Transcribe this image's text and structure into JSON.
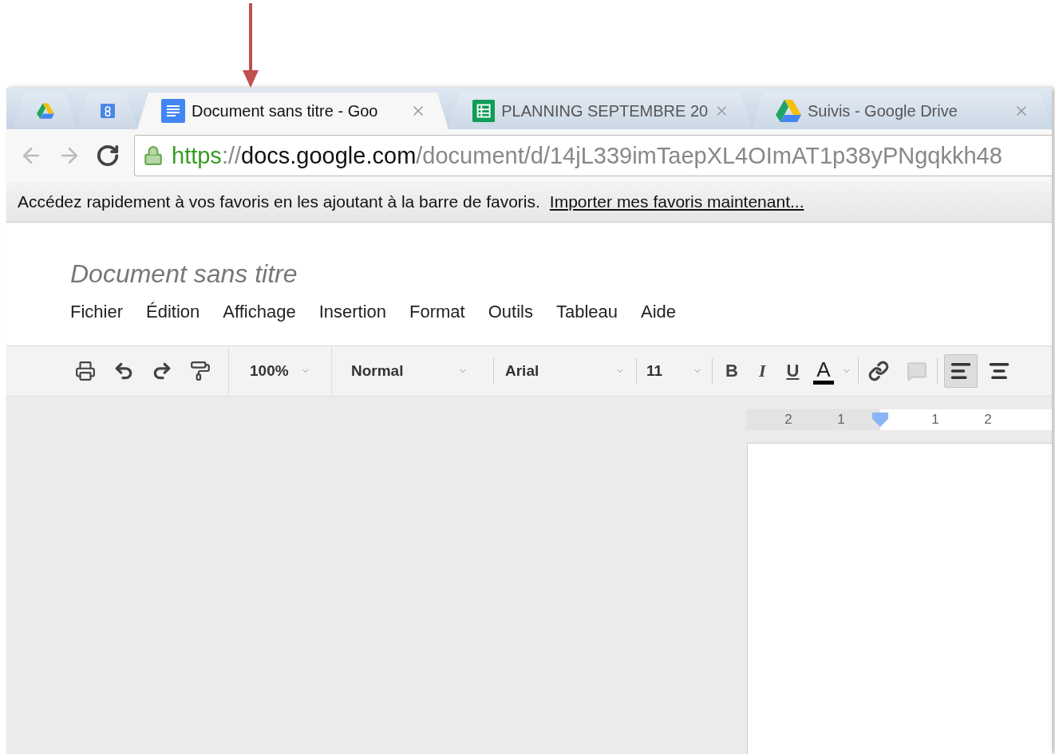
{
  "browser": {
    "tabs": [
      {
        "kind": "pinned",
        "selected": false
      },
      {
        "kind": "pinned",
        "selected": false
      },
      {
        "kind": "normal",
        "title": "Document sans titre - Goo",
        "selected": true
      },
      {
        "kind": "normal",
        "title": "PLANNING SEPTEMBRE 20",
        "selected": false
      },
      {
        "kind": "normal",
        "title": "Suivis - Google Drive",
        "selected": false
      }
    ],
    "address": {
      "secure": true,
      "scheme": "https",
      "separator": "://",
      "host": "docs.google.com",
      "path": "/document/d/14jL339imTaepXL4OImAT1p38yPNgqkkh48"
    },
    "bookmarks_bar": {
      "message": "Accédez rapidement à vos favoris en les ajoutant à la barre de favoris.",
      "link": "Importer mes favoris maintenant..."
    }
  },
  "document": {
    "title": "Document sans titre",
    "menus": [
      "Fichier",
      "Édition",
      "Affichage",
      "Insertion",
      "Format",
      "Outils",
      "Tableau",
      "Aide"
    ]
  },
  "toolbar": {
    "zoom": "100%",
    "style": "Normal",
    "font": "Arial",
    "size": "11",
    "bold": "B",
    "italic": "I",
    "underline": "U",
    "text_color": "A",
    "align": [
      {
        "kind": "left",
        "selected": true
      },
      {
        "kind": "center",
        "selected": false
      }
    ]
  },
  "ruler": {
    "left_labels": [
      "2",
      "1"
    ],
    "right_labels": [
      "1",
      "2"
    ]
  }
}
